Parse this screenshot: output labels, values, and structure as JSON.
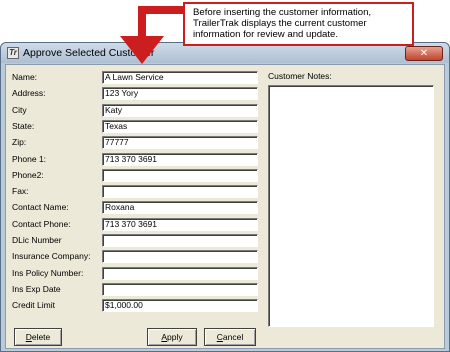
{
  "callout": {
    "line1": "Before inserting the customer information,",
    "line2": "TrailerTrak displays the current customer",
    "line3": "information for review and update."
  },
  "window": {
    "title": "Approve Selected Customer",
    "icon_letter": "Tr",
    "close_glyph": "✕"
  },
  "form": {
    "fields": [
      {
        "label": "Name:",
        "value": "A Lawn Service"
      },
      {
        "label": "Address:",
        "value": "123 Yory"
      },
      {
        "label": "City",
        "value": "Katy"
      },
      {
        "label": "State:",
        "value": "Texas"
      },
      {
        "label": "Zip:",
        "value": "77777"
      },
      {
        "label": "Phone 1:",
        "value": "713 370 3691"
      },
      {
        "label": "Phone2:",
        "value": ""
      },
      {
        "label": "Fax:",
        "value": ""
      },
      {
        "label": "Contact Name:",
        "value": "Roxana"
      },
      {
        "label": "Contact Phone:",
        "value": "713 370 3691"
      },
      {
        "label": "DLic Number",
        "value": ""
      },
      {
        "label": "Insurance Company:",
        "value": ""
      },
      {
        "label": "Ins Policy Number:",
        "value": ""
      },
      {
        "label": "Ins Exp Date",
        "value": ""
      },
      {
        "label": "Credit Limit",
        "value": "$1,000.00"
      }
    ],
    "notes_label": "Customer Notes:",
    "notes_value": ""
  },
  "buttons": {
    "delete_first": "D",
    "delete_rest": "elete",
    "apply_first": "A",
    "apply_rest": "pply",
    "cancel_first": "C",
    "cancel_rest": "ancel"
  },
  "colors": {
    "callout_red": "#cc1e1e",
    "window_frame": "#b9cadb",
    "dialog_face": "#ece9d8"
  }
}
